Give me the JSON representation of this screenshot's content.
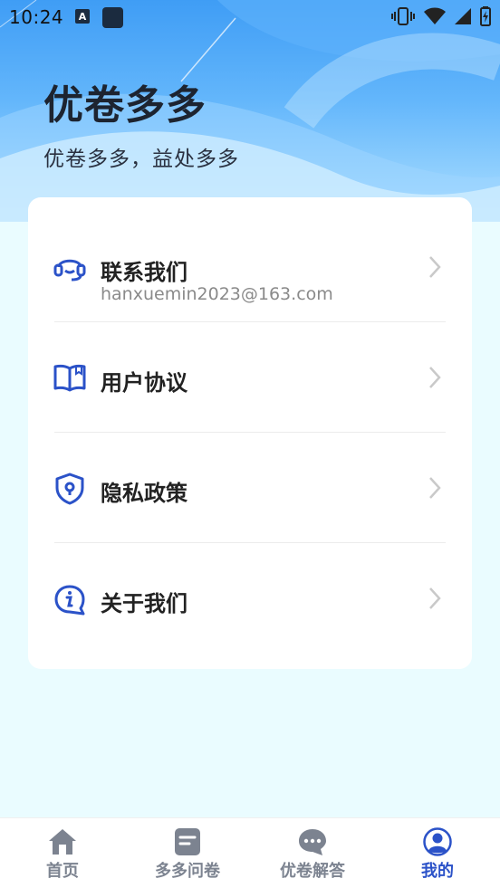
{
  "status_bar": {
    "time": "10:24",
    "a_badge": "A"
  },
  "header": {
    "title": "优卷多多",
    "subtitle": "优卷多多，益处多多"
  },
  "menu": [
    {
      "label": "联系我们",
      "sub": "hanxuemin2023@163.com",
      "icon": "headset-icon"
    },
    {
      "label": "用户协议",
      "icon": "book-icon"
    },
    {
      "label": "隐私政策",
      "icon": "shield-icon"
    },
    {
      "label": "关于我们",
      "icon": "info-icon"
    }
  ],
  "tabs": [
    {
      "label": "首页",
      "icon": "home-icon",
      "active": false
    },
    {
      "label": "多多问卷",
      "icon": "survey-icon",
      "active": false
    },
    {
      "label": "优卷解答",
      "icon": "chat-icon",
      "active": false
    },
    {
      "label": "我的",
      "icon": "profile-icon",
      "active": true
    }
  ],
  "colors": {
    "accent": "#2b52c8",
    "inactive": "#7c8390",
    "hero": "#3f9df5",
    "background": "#eafcff"
  }
}
